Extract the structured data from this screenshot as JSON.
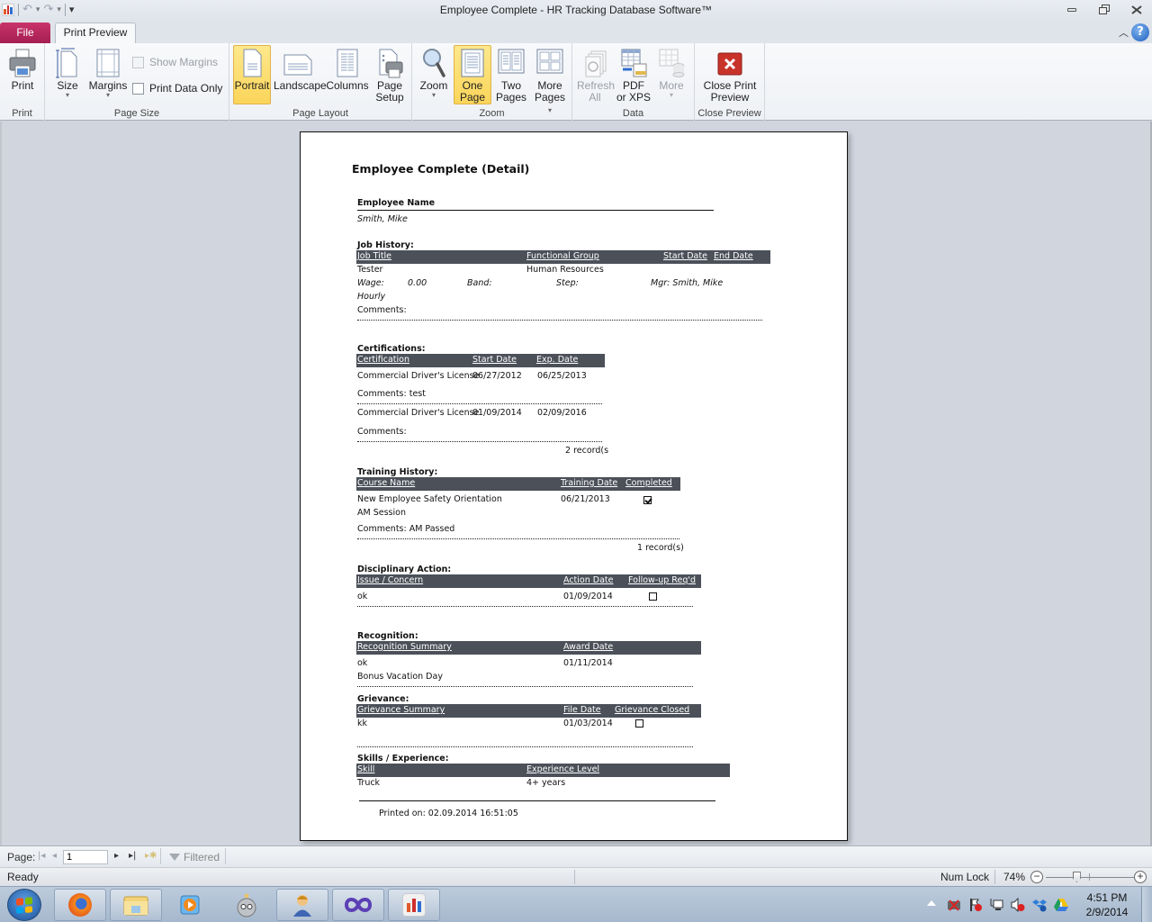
{
  "window": {
    "title": "Employee Complete  -  HR Tracking Database Software™",
    "controls": {
      "minimize": "minimize",
      "restore": "restore",
      "close": "close"
    }
  },
  "quick_access": {
    "undo": "↶",
    "redo": "↷",
    "customize": "▾"
  },
  "tabs": {
    "file": "File",
    "active": "Print Preview"
  },
  "ribbon": {
    "groups": {
      "print": {
        "label": "Print",
        "buttons": {
          "print": "Print"
        }
      },
      "page_size": {
        "label": "Page Size",
        "buttons": {
          "size": "Size",
          "margins": "Margins"
        },
        "checkboxes": {
          "show_margins": {
            "label": "Show Margins",
            "checked": false,
            "enabled": false
          },
          "print_data_only": {
            "label": "Print Data Only",
            "checked": false,
            "enabled": true
          }
        }
      },
      "page_layout": {
        "label": "Page Layout",
        "buttons": {
          "portrait": "Portrait",
          "landscape": "Landscape",
          "columns": "Columns",
          "page_setup_1": "Page",
          "page_setup_2": "Setup"
        }
      },
      "zoom": {
        "label": "Zoom",
        "buttons": {
          "zoom": "Zoom",
          "one_page_1": "One",
          "one_page_2": "Page",
          "two_pages_1": "Two",
          "two_pages_2": "Pages",
          "more_pages_1": "More",
          "more_pages_2": "Pages"
        }
      },
      "data": {
        "label": "Data",
        "buttons": {
          "refresh_1": "Refresh",
          "refresh_2": "All",
          "pdf_1": "PDF",
          "pdf_2": "or XPS",
          "more": "More"
        }
      },
      "close_preview": {
        "label": "Close Preview",
        "buttons": {
          "close_1": "Close Print",
          "close_2": "Preview"
        }
      }
    }
  },
  "report": {
    "title": "Employee Complete (Detail)",
    "employee": {
      "label": "Employee Name",
      "value": "Smith, Mike"
    },
    "job_history": {
      "heading": "Job History:",
      "columns": [
        "Job Title",
        "Functional Group",
        "Start Date",
        "End Date"
      ],
      "rows": [
        {
          "job_title": "Tester",
          "functional_group": "Human Resources",
          "start_date": "",
          "end_date": "",
          "wage_label": "Wage:",
          "wage": "0.00",
          "band_label": "Band:",
          "step_label": "Step:",
          "manager": "Mgr: Smith, Mike",
          "pay_type": "Hourly",
          "comments": "Comments:"
        }
      ]
    },
    "certifications": {
      "heading": "Certifications:",
      "columns": [
        "Certification",
        "Start Date",
        "Exp. Date"
      ],
      "rows": [
        {
          "certification": "Commercial Driver's License",
          "start_date": "06/27/2012",
          "exp_date": "06/25/2013",
          "comments": "Comments: test"
        },
        {
          "certification": "Commercial Driver's License",
          "start_date": "01/09/2014",
          "exp_date": "02/09/2016",
          "comments": "Comments:"
        }
      ],
      "record_count": "2 record(s"
    },
    "training_history": {
      "heading": "Training History:",
      "columns": [
        "Course Name",
        "Training Date",
        "Completed"
      ],
      "rows": [
        {
          "course_name": "New Employee Safety Orientation",
          "session": "AM Session",
          "training_date": "06/21/2013",
          "completed": true,
          "comments": "Comments: AM Passed"
        }
      ],
      "record_count": "1 record(s)"
    },
    "disciplinary_action": {
      "heading": "Disciplinary Action:",
      "columns": [
        "Issue / Concern",
        "Action Date",
        "Follow-up Req'd"
      ],
      "rows": [
        {
          "issue": "ok",
          "action_date": "01/09/2014",
          "follow_up": false
        }
      ]
    },
    "recognition": {
      "heading": "Recognition:",
      "columns": [
        "Recognition Summary",
        "Award Date"
      ],
      "rows": [
        {
          "summary": "ok",
          "detail": "Bonus Vacation Day",
          "award_date": "01/11/2014"
        }
      ]
    },
    "grievance": {
      "heading": "Grievance:",
      "columns": [
        "Grievance Summary",
        "File Date",
        "Grievance Closed"
      ],
      "rows": [
        {
          "summary": "kk",
          "file_date": "01/03/2014",
          "closed": false
        }
      ]
    },
    "skills": {
      "heading": "Skills / Experience:",
      "columns": [
        "Skill",
        "Experience Level"
      ],
      "rows": [
        {
          "skill": "Truck",
          "level": "4+ years"
        }
      ]
    },
    "footer": {
      "printed_on": "Printed on: 02.09.2014 16:51:05"
    }
  },
  "navigation": {
    "page_label": "Page:",
    "page_value": "1",
    "first": "⏮",
    "prev": "◂",
    "next": "▸",
    "last": "⏭",
    "new": "▸*",
    "filter_label": "Filtered"
  },
  "status": {
    "text": "Ready",
    "num_lock": "Num Lock",
    "zoom_percent": "74%",
    "zoom_value": 74,
    "zoom_minus": "−",
    "zoom_plus": "+"
  },
  "taskbar": {
    "apps": [
      "firefox",
      "windows-explorer",
      "media-player",
      "robot-app",
      "user-support-app",
      "infinity-app",
      "hr-tracking-app"
    ],
    "clock_time": "4:51 PM",
    "clock_date": "2/9/2014",
    "tray_icons": [
      "network-disconnected",
      "action-center-alert",
      "network",
      "volume-muted",
      "dropbox",
      "google-drive-alert"
    ]
  }
}
